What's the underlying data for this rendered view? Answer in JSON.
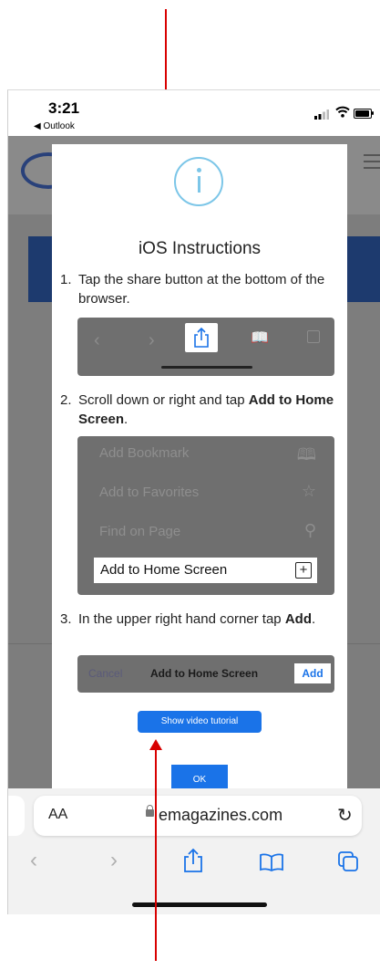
{
  "status_bar": {
    "time": "3:21",
    "back_app": "◀ Outlook"
  },
  "modal": {
    "title": "iOS Instructions",
    "step1": {
      "num": "1.",
      "text": "Tap the share button at the bottom of the browser."
    },
    "step2": {
      "num": "2.",
      "text_pre": "Scroll down or right and tap ",
      "text_bold": "Add to Home Screen",
      "text_post": "."
    },
    "step2_menu": [
      {
        "label": "Add Bookmark",
        "icon": "book-icon"
      },
      {
        "label": "Add to Favorites",
        "icon": "star-icon"
      },
      {
        "label": "Find on Page",
        "icon": "search-icon"
      }
    ],
    "step2_highlight": "Add to Home Screen",
    "step3": {
      "num": "3.",
      "text_pre": "In the upper right hand corner tap ",
      "text_bold": "Add",
      "text_post": "."
    },
    "step3_bar": {
      "cancel": "Cancel",
      "title": "Add to Home Screen",
      "add": "Add"
    },
    "video_button": "Show video tutorial",
    "ok_button": "OK"
  },
  "browser": {
    "aa": "AA",
    "domain": "emagazines.com"
  },
  "colors": {
    "accent": "#1a73e8",
    "info_ring": "#7cc6e8",
    "annotation_arrow": "#d80000"
  }
}
